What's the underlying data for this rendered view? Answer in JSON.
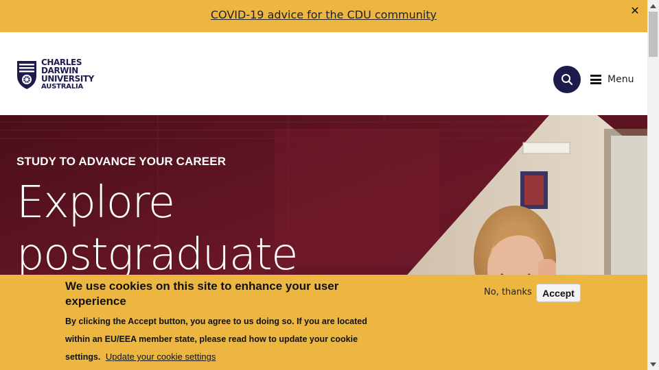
{
  "alert": {
    "link_text": "COVID-19 advice for the CDU community",
    "close_symbol": "✕"
  },
  "header": {
    "logo": {
      "line1": "CHARLES",
      "line2": "DARWIN",
      "line3": "UNIVERSITY",
      "line4": "AUSTRALIA"
    },
    "search_icon": "search-icon",
    "menu_label": "Menu"
  },
  "hero": {
    "eyebrow": "STUDY TO ADVANCE YOUR CAREER",
    "title_line1": "Explore",
    "title_line2": "postgraduate"
  },
  "cookie_banner": {
    "title": "We use cookies on this site to enhance your user experience",
    "body": "By clicking the Accept button, you agree to us doing so. If you are located within an EU/EEA member state, please read how to update your cookie settings.",
    "settings_link": "Update your cookie settings",
    "no_thanks_label": "No, thanks",
    "accept_label": "Accept"
  },
  "colors": {
    "accent_yellow": "#ecb640",
    "navy": "#1d1b4b",
    "hero_maroon": "#5b1420"
  }
}
